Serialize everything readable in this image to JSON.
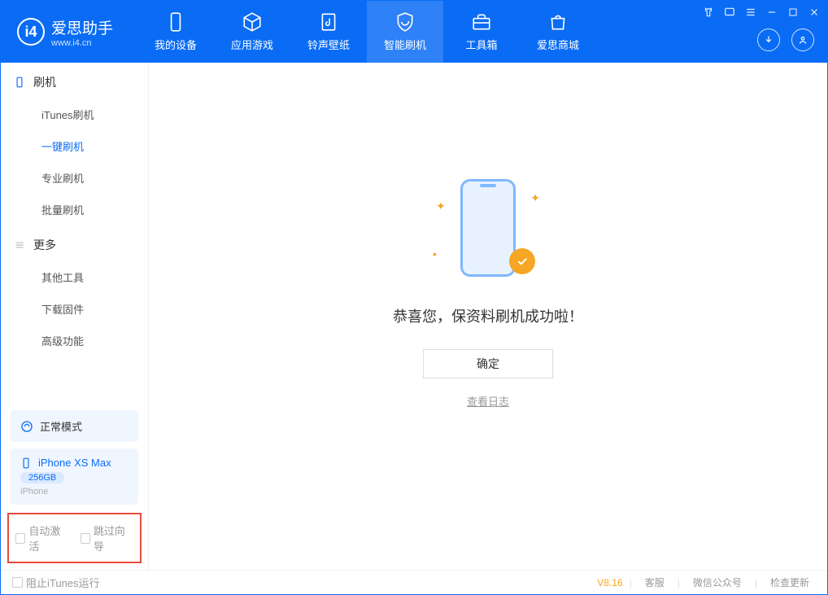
{
  "app": {
    "name": "爱思助手",
    "domain": "www.i4.cn"
  },
  "nav": {
    "tabs": [
      {
        "label": "我的设备"
      },
      {
        "label": "应用游戏"
      },
      {
        "label": "铃声壁纸"
      },
      {
        "label": "智能刷机"
      },
      {
        "label": "工具箱"
      },
      {
        "label": "爱思商城"
      }
    ]
  },
  "sidebar": {
    "section1": {
      "title": "刷机",
      "items": [
        "iTunes刷机",
        "一键刷机",
        "专业刷机",
        "批量刷机"
      ],
      "active_index": 1
    },
    "section2": {
      "title": "更多",
      "items": [
        "其他工具",
        "下载固件",
        "高级功能"
      ]
    },
    "mode": "正常模式",
    "device": {
      "name": "iPhone XS Max",
      "storage": "256GB",
      "type": "iPhone"
    },
    "checkboxes": {
      "auto_activate": "自动激活",
      "skip_guide": "跳过向导"
    }
  },
  "main": {
    "success_message": "恭喜您，保资料刷机成功啦！",
    "ok_button": "确定",
    "view_log": "查看日志"
  },
  "statusbar": {
    "prevent_itunes": "阻止iTunes运行",
    "version": "V8.16",
    "links": [
      "客服",
      "微信公众号",
      "检查更新"
    ]
  },
  "colors": {
    "primary": "#0a6cf5",
    "accent": "#f5a623",
    "highlight_border": "#e74c3c"
  }
}
